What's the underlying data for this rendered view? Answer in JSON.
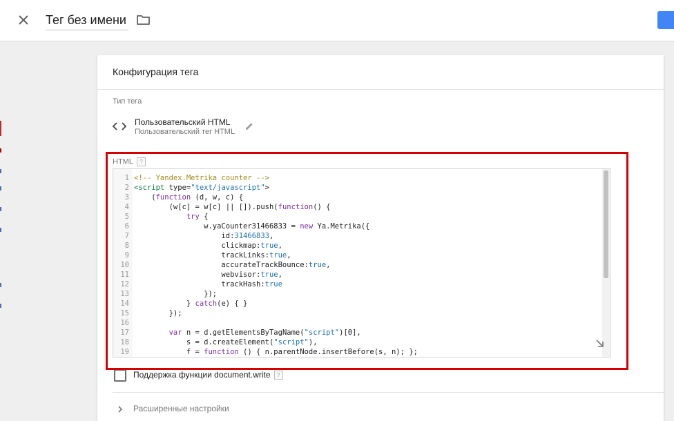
{
  "header": {
    "title": "Тег без имени"
  },
  "card": {
    "header": "Конфигурация тега",
    "tag_type_label": "Тип тега",
    "tag_type_name": "Пользовательский HTML",
    "tag_type_description": "Пользовательский тег HTML",
    "html_label": "HTML",
    "help_mark": "?",
    "code_lines": [
      {
        "n": "1",
        "text": "<!-- Yandex.Metrika counter -->"
      },
      {
        "n": "2",
        "text": "<script type=\"text/javascript\">"
      },
      {
        "n": "3",
        "text": "    (function (d, w, c) {"
      },
      {
        "n": "4",
        "text": "        (w[c] = w[c] || []).push(function() {"
      },
      {
        "n": "5",
        "text": "            try {"
      },
      {
        "n": "6",
        "text": "                w.yaCounter31466833 = new Ya.Metrika({"
      },
      {
        "n": "7",
        "text": "                    id:31466833,"
      },
      {
        "n": "8",
        "text": "                    clickmap:true,"
      },
      {
        "n": "9",
        "text": "                    trackLinks:true,"
      },
      {
        "n": "10",
        "text": "                    accurateTrackBounce:true,"
      },
      {
        "n": "11",
        "text": "                    webvisor:true,"
      },
      {
        "n": "12",
        "text": "                    trackHash:true"
      },
      {
        "n": "13",
        "text": "                });"
      },
      {
        "n": "14",
        "text": "            } catch(e) { }"
      },
      {
        "n": "15",
        "text": "        });"
      },
      {
        "n": "16",
        "text": ""
      },
      {
        "n": "17",
        "text": "        var n = d.getElementsByTagName(\"script\")[0],"
      },
      {
        "n": "18",
        "text": "            s = d.createElement(\"script\"),"
      },
      {
        "n": "19",
        "text": "            f = function () { n.parentNode.insertBefore(s, n); };"
      }
    ],
    "document_write_label": "Поддержка функции document.write",
    "document_write_checked": false,
    "advanced_label": "Расширенные настройки"
  },
  "colors": {
    "accent": "#4285f4",
    "highlight": "#d40000"
  },
  "icons": {
    "close": "close-icon",
    "folder": "folder-icon",
    "code": "code-icon",
    "edit": "pencil-icon",
    "resize": "resize-handle-icon",
    "expand": "chevron-right-icon"
  }
}
